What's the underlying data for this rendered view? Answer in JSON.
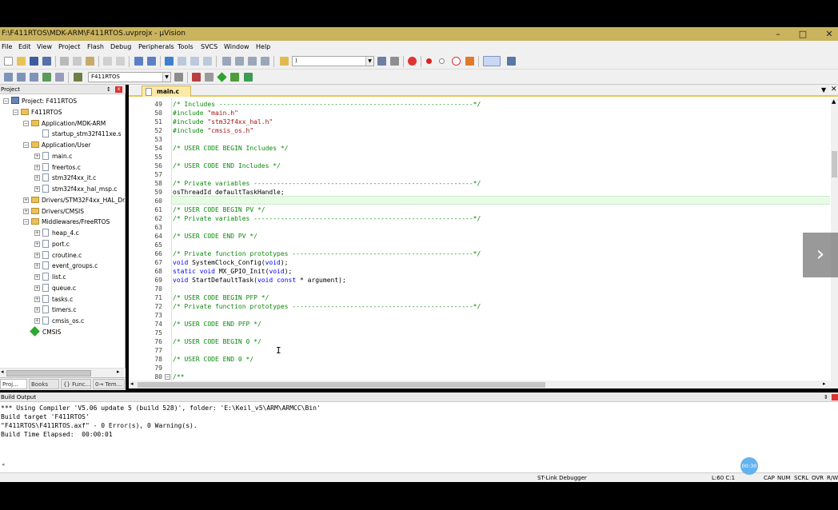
{
  "window": {
    "title": "F:\\F411RTOS\\MDK-ARM\\F411RTOS.uvprojx - µVision",
    "minimize": "–",
    "maximize": "□",
    "close": "✕"
  },
  "menu": [
    "File",
    "Edit",
    "View",
    "Project",
    "Flash",
    "Debug",
    "Peripherals",
    "Tools",
    "SVCS",
    "Window",
    "Help"
  ],
  "toolbar": {
    "find_combo": ")",
    "target_combo": "F411RTOS"
  },
  "project_panel": {
    "title": "Project",
    "pin": "↕",
    "close": "x",
    "tree": [
      {
        "label": "Project: F411RTOS",
        "kind": "proj"
      },
      {
        "label": "F411RTOS",
        "kind": "folder"
      },
      {
        "label": "Application/MDK-ARM",
        "kind": "folder"
      },
      {
        "label": "startup_stm32f411xe.s",
        "kind": "file"
      },
      {
        "label": "Application/User",
        "kind": "folder"
      },
      {
        "label": "main.c",
        "kind": "file"
      },
      {
        "label": "freertos.c",
        "kind": "file"
      },
      {
        "label": "stm32f4xx_it.c",
        "kind": "file"
      },
      {
        "label": "stm32f4xx_hal_msp.c",
        "kind": "file"
      },
      {
        "label": "Drivers/STM32F4xx_HAL_Dr",
        "kind": "folder"
      },
      {
        "label": "Drivers/CMSIS",
        "kind": "folder"
      },
      {
        "label": "Middlewares/FreeRTOS",
        "kind": "folder"
      },
      {
        "label": "heap_4.c",
        "kind": "file"
      },
      {
        "label": "port.c",
        "kind": "file"
      },
      {
        "label": "croutine.c",
        "kind": "file"
      },
      {
        "label": "event_groups.c",
        "kind": "file"
      },
      {
        "label": "list.c",
        "kind": "file"
      },
      {
        "label": "queue.c",
        "kind": "file"
      },
      {
        "label": "tasks.c",
        "kind": "file"
      },
      {
        "label": "timers.c",
        "kind": "file"
      },
      {
        "label": "cmsis_os.c",
        "kind": "file"
      },
      {
        "label": "CMSIS",
        "kind": "gem"
      }
    ],
    "tabs": [
      "Proj...",
      "Books",
      "{} Func...",
      "0→ Tem..."
    ]
  },
  "editor": {
    "tab": "main.c",
    "lines": [
      {
        "n": "49",
        "t": "/* Includes ------------------------------------------------------------------*/",
        "c": "comment"
      },
      {
        "n": "50",
        "t": "#include \"main.h\"",
        "c": "include"
      },
      {
        "n": "51",
        "t": "#include \"stm32f4xx_hal.h\"",
        "c": "include"
      },
      {
        "n": "52",
        "t": "#include \"cmsis_os.h\"",
        "c": "include"
      },
      {
        "n": "53",
        "t": "",
        "c": "plain"
      },
      {
        "n": "54",
        "t": "/* USER CODE BEGIN Includes */",
        "c": "comment"
      },
      {
        "n": "55",
        "t": "",
        "c": "plain"
      },
      {
        "n": "56",
        "t": "/* USER CODE END Includes */",
        "c": "comment"
      },
      {
        "n": "57",
        "t": "",
        "c": "plain"
      },
      {
        "n": "58",
        "t": "/* Private variables ---------------------------------------------------------*/",
        "c": "comment"
      },
      {
        "n": "59",
        "t": "osThreadId defaultTaskHandle;",
        "c": "plain"
      },
      {
        "n": "60",
        "t": "",
        "c": "plain"
      },
      {
        "n": "61",
        "t": "/* USER CODE BEGIN PV */",
        "c": "comment"
      },
      {
        "n": "62",
        "t": "/* Private variables ---------------------------------------------------------*/",
        "c": "comment"
      },
      {
        "n": "63",
        "t": "",
        "c": "plain"
      },
      {
        "n": "64",
        "t": "/* USER CODE END PV */",
        "c": "comment"
      },
      {
        "n": "65",
        "t": "",
        "c": "plain"
      },
      {
        "n": "66",
        "t": "/* Private function prototypes -----------------------------------------------*/",
        "c": "comment"
      },
      {
        "n": "67",
        "t": "void SystemClock_Config(void);",
        "c": "decl"
      },
      {
        "n": "68",
        "t": "static void MX_GPIO_Init(void);",
        "c": "decl"
      },
      {
        "n": "69",
        "t": "void StartDefaultTask(void const * argument);",
        "c": "decl"
      },
      {
        "n": "70",
        "t": "",
        "c": "plain"
      },
      {
        "n": "71",
        "t": "/* USER CODE BEGIN PFP */",
        "c": "comment"
      },
      {
        "n": "72",
        "t": "/* Private function prototypes -----------------------------------------------*/",
        "c": "comment"
      },
      {
        "n": "73",
        "t": "",
        "c": "plain"
      },
      {
        "n": "74",
        "t": "/* USER CODE END PFP */",
        "c": "comment"
      },
      {
        "n": "75",
        "t": "",
        "c": "plain"
      },
      {
        "n": "76",
        "t": "/* USER CODE BEGIN 0 */",
        "c": "comment"
      },
      {
        "n": "77",
        "t": "",
        "c": "plain"
      },
      {
        "n": "78",
        "t": "/* USER CODE END 0 */",
        "c": "comment"
      },
      {
        "n": "79",
        "t": "",
        "c": "plain"
      },
      {
        "n": "80",
        "t": "/**",
        "c": "comment"
      }
    ],
    "current_line": "60"
  },
  "build_output": {
    "title": "Build Output",
    "lines": [
      "*** Using Compiler 'V5.06 update 5 (build 528)', folder: 'E:\\Keil_v5\\ARM\\ARMCC\\Bin'",
      "Build target 'F411RTOS'",
      "\"F411RTOS\\F411RTOS.axf\" - 0 Error(s), 0 Warning(s).",
      "Build Time Elapsed:  00:00:01"
    ]
  },
  "status": {
    "debugger": "ST-Link Debugger",
    "position": "L:60 C:1",
    "caps": "CAP",
    "num": "NUM",
    "scrl": "SCRL",
    "ovr": "OVR",
    "rw": "R/W"
  },
  "overlay": {
    "next": "›",
    "timer": "00:30"
  },
  "colors": {
    "titlebar": "#c9b35d",
    "comment": "#0a8a0a",
    "include": "#a31515",
    "keyword": "#0000ff",
    "timer": "#62b3ee"
  }
}
